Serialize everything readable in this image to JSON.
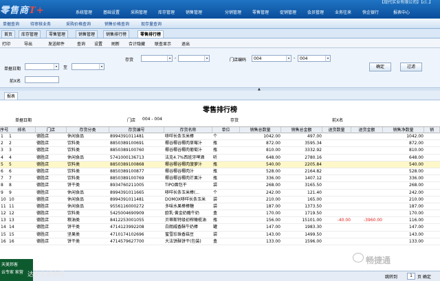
{
  "app": {
    "logo": "零售商",
    "logo_accent": "T+",
    "sysinfo": "【现代实业有限公司】【cl..】"
  },
  "top_nav": [
    "系统管理",
    "基础设置",
    "采购管理",
    "库存管理",
    "销售管理",
    "分销管理",
    "零售管理",
    "促销管理",
    "会员管理",
    "业务往来",
    "快企银行",
    "报表中心"
  ],
  "quick_tabs": [
    "单据查询",
    "待审核业务",
    "采购价格查询",
    "销售价格查询",
    "现存量查询"
  ],
  "page_tabs": [
    "首页",
    "库存管理",
    "零售管理",
    "销售管理",
    "销售排行榜",
    "零售排行榜"
  ],
  "active_tab_index": 5,
  "menu": [
    "打印",
    "导出",
    "发送邮件",
    "查询",
    "设置",
    "刷新",
    "合计隐藏",
    "联查显示",
    "退出"
  ],
  "filter": {
    "date_label": "单据日期",
    "to_label": "至",
    "date_from": "",
    "date_to": "",
    "stock_label": "存货",
    "stock_from": "",
    "stock_to": "",
    "store_label": "门店编码",
    "store_from": "004",
    "store_to": "004",
    "name_label": "前X名",
    "name_value": "",
    "ok_label": "确定",
    "filter_label": "过滤"
  },
  "report_tab": "报表",
  "report": {
    "title": "零售排行榜",
    "date_label": "单据日期",
    "store_label": "门店",
    "store_value": "004 - 004",
    "stock_label": "存货",
    "topn_label": "前X名"
  },
  "columns": [
    "序号",
    "排名",
    "门店",
    "存货分类",
    "存货编号",
    "存货名称",
    "单位",
    "销售总数量",
    "销售总金额",
    "退货数量",
    "退货金额",
    "销售净数量",
    "销"
  ],
  "rows": [
    [
      "1",
      "1",
      "德胜店",
      "休闲食品",
      "8994391011481",
      "哆咩长条玉米棒",
      "个",
      "1042.00",
      "497.00",
      "",
      "",
      "1042.00",
      ""
    ],
    [
      "2",
      "2",
      "德胜店",
      "饮料类",
      "8850389100691",
      "椰谷椰谷椰肉草莓汁",
      "瓶",
      "872.00",
      "3595.34",
      "",
      "",
      "872.00",
      ""
    ],
    [
      "3",
      "3",
      "德胜店",
      "饮料类",
      "8850389100760",
      "椰谷椰谷椰肉葡萄汁",
      "瓶",
      "810.00",
      "3332.92",
      "",
      "",
      "810.00",
      ""
    ],
    [
      "4",
      "4",
      "德胜店",
      "休闲食品",
      "5741000136713",
      "法克4.7%西班牙啤酒",
      "听",
      "648.00",
      "2780.16",
      "",
      "",
      "648.00",
      ""
    ],
    [
      "5",
      "5",
      "德胜店",
      "饮料类",
      "8850389100868",
      "椰谷椰谷椰肉菠萝汁",
      "瓶",
      "540.00",
      "2205.84",
      "",
      "",
      "540.00",
      ""
    ],
    [
      "6",
      "6",
      "德胜店",
      "饮料类",
      "8850389100877",
      "椰谷椰谷椰肉汁",
      "瓶",
      "528.00",
      "2164.82",
      "",
      "",
      "528.00",
      ""
    ],
    [
      "7",
      "7",
      "德胜店",
      "饮料类",
      "8850389100769",
      "椰谷椰谷椰肉芒果汁",
      "瓶",
      "336.00",
      "1407.12",
      "",
      "",
      "336.00",
      ""
    ],
    [
      "8",
      "8",
      "德胜店",
      "饼干类",
      "8934760211005",
      "TIPO面包干",
      "袋",
      "268.00",
      "3165.50",
      "",
      "",
      "268.00",
      ""
    ],
    [
      "9",
      "9",
      "德胜店",
      "休闲食品",
      "8994391011665",
      "哆咩长条玉米棒(...",
      "个",
      "242.00",
      "121.40",
      "",
      "",
      "242.00",
      ""
    ],
    [
      "10",
      "10",
      "德胜店",
      "休闲食品",
      "8994391011481",
      "DOMOX哆咩长条玉米",
      "袋",
      "210.00",
      "165.00",
      "",
      "",
      "210.00",
      ""
    ],
    [
      "11",
      "11",
      "德胜店",
      "休闲食品",
      "9556116000272",
      "多味水果棒棒糖",
      "袋",
      "187.00",
      "1373.50",
      "",
      "",
      "187.00",
      ""
    ],
    [
      "12",
      "12",
      "德胜店",
      "饮料类",
      "5425004690909",
      "欧乳·黄金奶酪牛奶",
      "盒",
      "170.00",
      "1719.50",
      "",
      "",
      "170.00",
      ""
    ],
    [
      "13",
      "13",
      "德胜店",
      "粮油类",
      "8412253001055",
      "贝蒂斯特级初榨橄榄油",
      "瓶",
      "156.00",
      "15101.00",
      "-40.00",
      "-3960.00",
      "116.00",
      ""
    ],
    [
      "14",
      "14",
      "德胜店",
      "饼干类",
      "4714123992208",
      "白朗威香酥牛奶棒",
      "罐",
      "147.00",
      "1983.30",
      "",
      "",
      "147.00",
      ""
    ],
    [
      "15",
      "15",
      "德胜店",
      "坚果类",
      "4710174102696",
      "蜜雪珍珠香菇豆",
      "袋",
      "143.00",
      "1499.50",
      "",
      "",
      "143.00",
      ""
    ],
    [
      "16",
      "16",
      "德胜店",
      "饼干类",
      "4714579627700",
      "大法饼酥饼干(包装)",
      "盒",
      "133.00",
      "1596.00",
      "",
      "",
      "133.00",
      ""
    ]
  ],
  "status": {
    "jump_label": "跳转到",
    "page_value": "1",
    "page_suffix": "页 确定"
  },
  "taskbar": {
    "line1": "天美邦客",
    "line2": "云专家 家营"
  },
  "watermark": {
    "brand": "畅捷通",
    "sub": "达来大新客报"
  }
}
